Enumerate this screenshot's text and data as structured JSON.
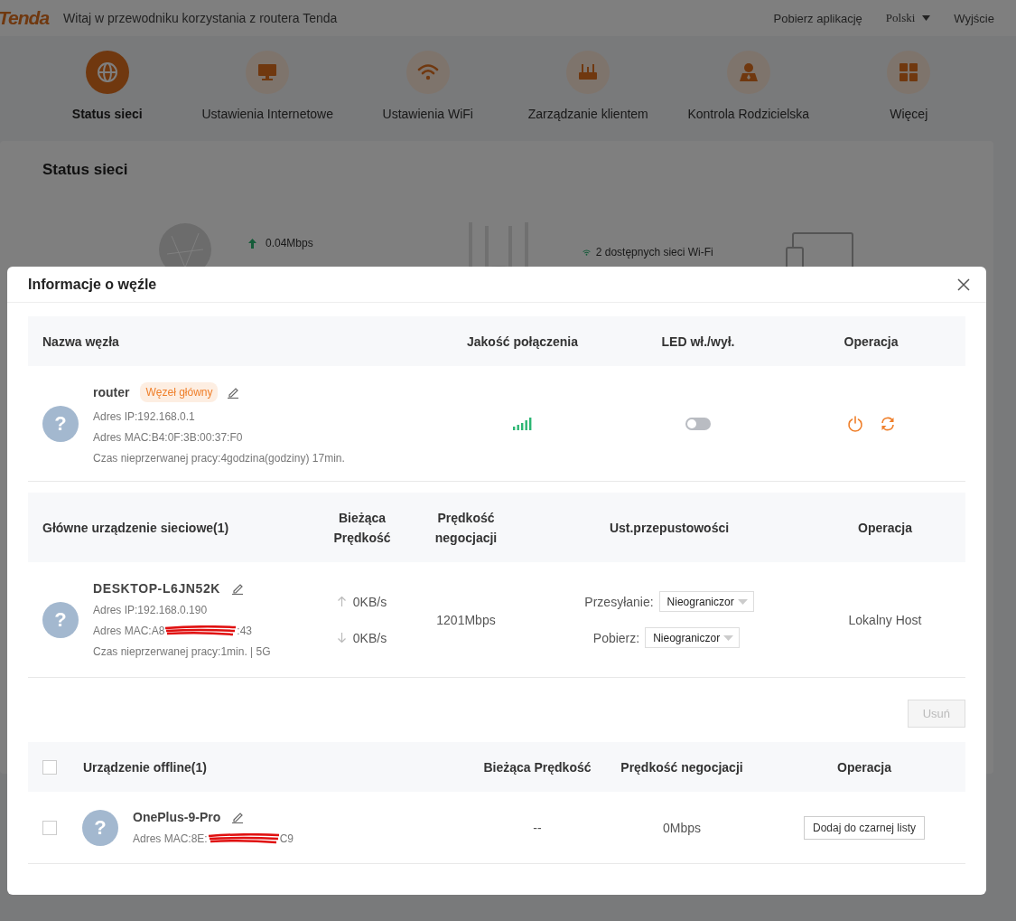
{
  "header": {
    "logo": "Tenda",
    "welcome": "Witaj w przewodniku korzystania z routera Tenda",
    "links": [
      {
        "label": "Pobierz aplikację",
        "kind": "link"
      },
      {
        "label": "Polski",
        "kind": "dropdown"
      },
      {
        "label": "Wyjście",
        "kind": "link"
      }
    ]
  },
  "nav": [
    {
      "label": "Status sieci",
      "kind": "globe",
      "selected": true
    },
    {
      "label": "Ustawienia Internetowe",
      "kind": "monitor",
      "selected": false
    },
    {
      "label": "Ustawienia WiFi",
      "kind": "wifi",
      "selected": false
    },
    {
      "label": "Zarządzanie klientem",
      "kind": "router",
      "selected": false
    },
    {
      "label": "Kontrola Rodzicielska",
      "kind": "person",
      "selected": false
    },
    {
      "label": "Więcej",
      "kind": "grid",
      "selected": false
    }
  ],
  "status_card": {
    "title": "Status sieci",
    "upload": "0.04Mbps",
    "wifi": "2 dostępnych sieci Wi-Fi"
  },
  "modal": {
    "title": "Informacje o węźle",
    "node_table": {
      "columns": [
        "Nazwa węzła",
        "Jakość połączenia",
        "LED wł./wył.",
        "Operacja"
      ],
      "rows": [
        {
          "avatar": "?",
          "name": "router",
          "tag": "Węzeł główny",
          "ip": "Adres IP:192.168.0.1",
          "mac": "Adres MAC:B4:0F:3B:00:37:F0",
          "uptime": "Czas nieprzerwanej pracy:4godzina(godziny) 17min.",
          "led_on": false
        }
      ]
    },
    "main_devices": {
      "columns": [
        "Główne urządzenie sieciowe(1)",
        "Bieżąca Prędkość",
        "Prędkość negocjacji",
        "Ust.przepustowości",
        "Operacja"
      ],
      "rows": [
        {
          "avatar": "?",
          "name": "DESKTOP-L6JN52K",
          "ip": "Adres IP:192.168.0.190",
          "mac_start": "Adres MAC:A8",
          "mac_end": ":43",
          "uptime": "Czas nieprzerwanej pracy:1min. | 5G",
          "up": "0KB/s",
          "down": "0KB/s",
          "negotiated": "1201Mbps",
          "upload_label": "Przesyłanie:",
          "upload_value": "Nieograniczor",
          "download_label": "Pobierz:",
          "download_value": "Nieograniczor",
          "operation": "Lokalny Host"
        }
      ]
    },
    "delete_button": {
      "label": "Usuń",
      "disabled": true
    },
    "offline_devices": {
      "select_all_checked": false,
      "columns": [
        "Urządzenie offline(1)",
        "Bieżąca Prędkość",
        "Prędkość negocjacji",
        "Operacja"
      ],
      "rows": [
        {
          "checked": false,
          "avatar": "?",
          "name": "OnePlus-9-Pro",
          "mac_start": "Adres MAC:8E:",
          "mac_end": "C9",
          "speed": "--",
          "negotiated": "0Mbps",
          "action": "Dodaj do czarnej listy"
        }
      ]
    }
  }
}
